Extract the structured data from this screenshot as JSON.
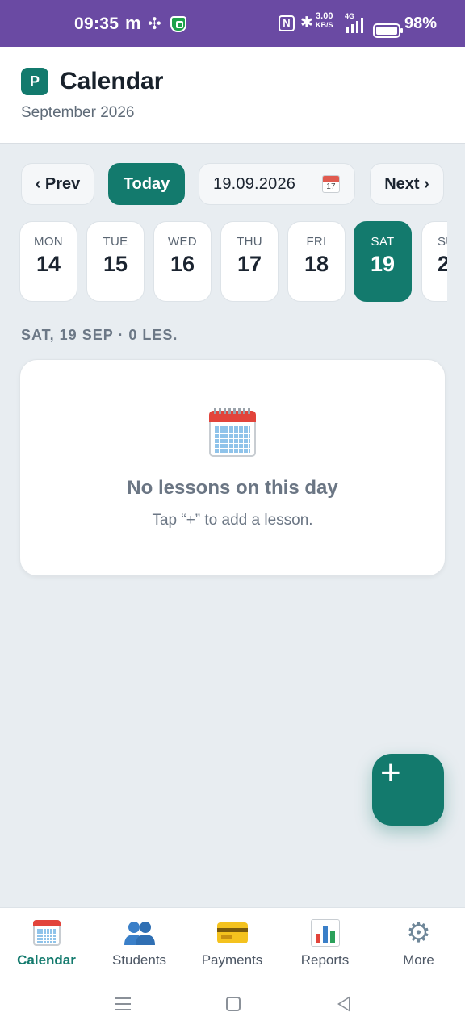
{
  "status_bar": {
    "time": "09:35",
    "carrier_letter": "m",
    "speed_value": "3.00",
    "speed_unit": "KB/S",
    "network": "4G",
    "battery_level": 98,
    "battery_text": "98%"
  },
  "header": {
    "logo_letter": "P",
    "title": "Calendar",
    "subtitle": "September 2026"
  },
  "nav": {
    "prev_label": "‹ Prev",
    "today_label": "Today",
    "date_value": "19.09.2026",
    "date_icon_day": "17",
    "next_label": "Next ›"
  },
  "days": [
    {
      "name": "MON",
      "date": "14",
      "selected": false
    },
    {
      "name": "TUE",
      "date": "15",
      "selected": false
    },
    {
      "name": "WED",
      "date": "16",
      "selected": false
    },
    {
      "name": "THU",
      "date": "17",
      "selected": false
    },
    {
      "name": "FRI",
      "date": "18",
      "selected": false
    },
    {
      "name": "SAT",
      "date": "19",
      "selected": true
    },
    {
      "name": "SU",
      "date": "2",
      "selected": false
    }
  ],
  "section_label": "SAT, 19 SEP · 0 LES.",
  "empty_state": {
    "title": "No lessons on this day",
    "subtitle": "Tap “+” to add a lesson."
  },
  "fab_label": "+",
  "bottom_nav": [
    {
      "label": "Calendar",
      "icon": "calendar-icon",
      "active": true
    },
    {
      "label": "Students",
      "icon": "students-icon",
      "active": false
    },
    {
      "label": "Payments",
      "icon": "credit-card-icon",
      "active": false
    },
    {
      "label": "Reports",
      "icon": "bar-chart-icon",
      "active": false
    },
    {
      "label": "More",
      "icon": "gear-icon",
      "active": false
    }
  ],
  "colors": {
    "accent": "#137a6d",
    "status_bar": "#6a4aa3",
    "background": "#e8edf1"
  }
}
